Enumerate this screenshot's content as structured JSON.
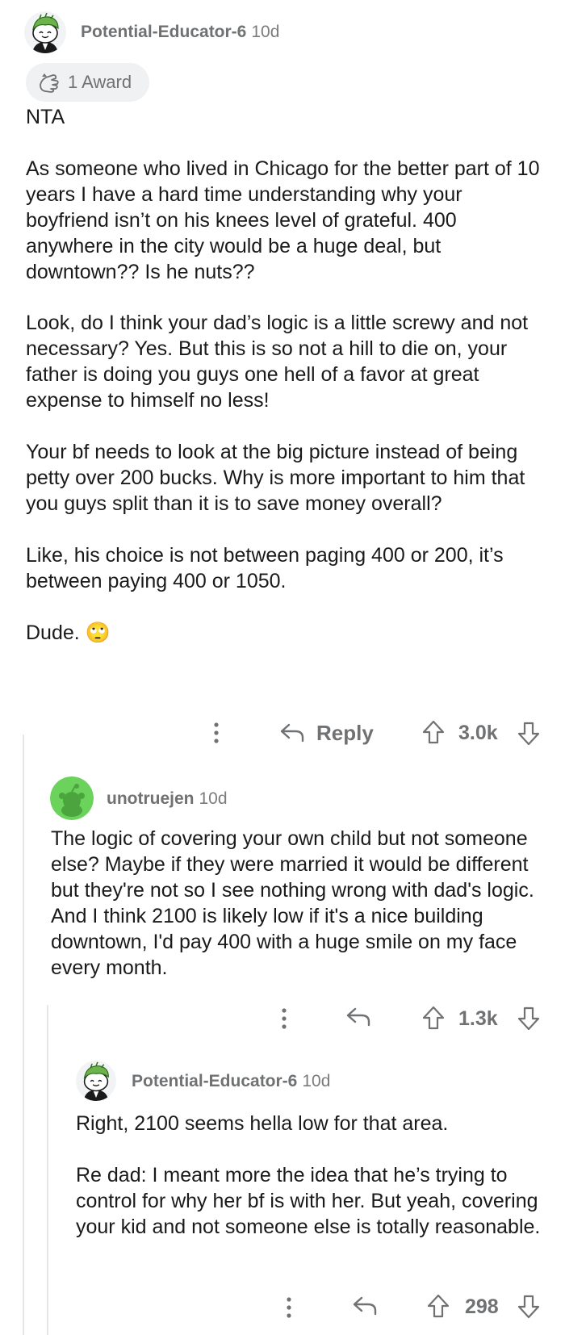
{
  "comments": [
    {
      "username": "Potential-Educator-6",
      "age": "10d",
      "avatar_icon": "snoo-avatar-icon",
      "award": {
        "icon": "award-icon",
        "label": "1 Award"
      },
      "paragraphs": [
        "NTA",
        "As someone who lived in Chicago for the better part of 10 years I have a hard time understanding why your boyfriend isn’t on his knees level of grateful. 400 anywhere in the city would be a huge deal, but downtown?? Is he nuts??",
        "Look, do I think your dad’s logic is a little screwy and not necessary? Yes. But this is so not a hill to die on, your father is doing you guys one hell of a favor at great expense to himself no less!",
        "Your bf needs to look at the big picture instead of being petty over 200 bucks. Why is more important to him that you guys split than it is to save money overall?",
        "Like, his choice is not between paging 400 or 200, it’s between paying 400 or 1050.",
        "Dude."
      ],
      "emoji": "🙄",
      "reply_label": "Reply",
      "score": "3.0k"
    },
    {
      "username": "unotruejen",
      "age": "10d",
      "avatar_icon": "snoo-avatar-icon",
      "paragraphs": [
        "The logic of covering your own child but not someone else? Maybe if they were married it would be different but they're not so I see nothing wrong with dad's logic. And I think 2100 is likely low if it's a nice building downtown, I'd pay 400 with a huge smile on my face every month."
      ],
      "score": "1.3k"
    },
    {
      "username": "Potential-Educator-6",
      "age": "10d",
      "avatar_icon": "snoo-avatar-icon",
      "paragraphs": [
        "Right, 2100 seems hella low for that area.",
        "Re dad: I meant more the idea that he’s trying to control for why her bf is with her. But yeah, covering your kid and not someone else is totally reasonable."
      ],
      "score": "298"
    }
  ],
  "colors": {
    "meta_gray": "#6f7173",
    "thread_line": "#e4e6e8",
    "avatar_green": "#6bd35c",
    "award_bg": "#eff1f3"
  }
}
